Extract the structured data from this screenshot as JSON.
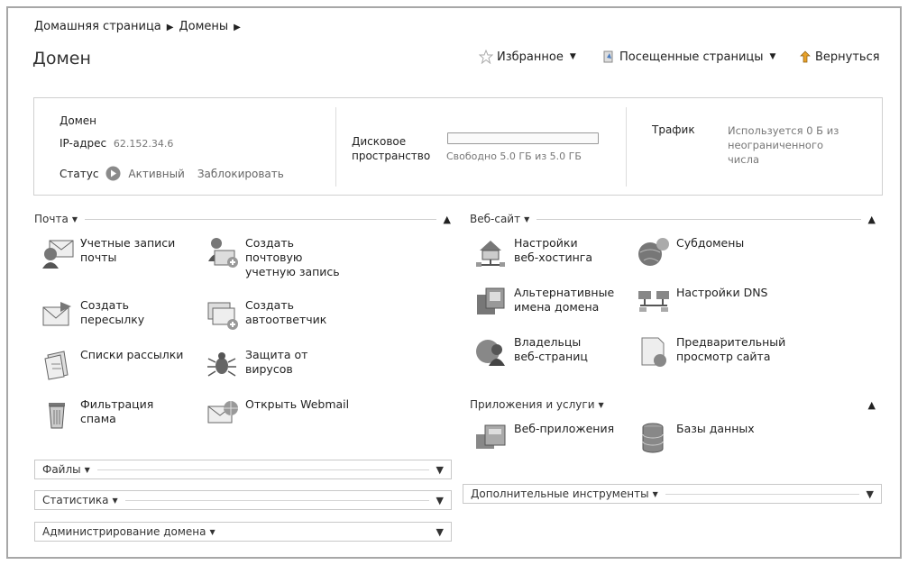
{
  "breadcrumb": {
    "items": [
      "Домашняя страница",
      "Домены"
    ],
    "separator": "▶"
  },
  "page_title": "Домен",
  "topnav": {
    "favorites": "Избранное",
    "visited": "Посещенные страницы",
    "back": "Вернуться"
  },
  "summary": {
    "domain_label": "Домен",
    "ip_label": "IP-адрес",
    "ip_value": "62.152.34.6",
    "status_label": "Статус",
    "status_value": "Активный",
    "block_action": "Заблокировать",
    "disk_label_1": "Дисковое",
    "disk_label_2": "пространство",
    "disk_value": "Свободно 5.0 ГБ из 5.0 ГБ",
    "disk_used_fraction": 0.0,
    "traffic_label": "Трафик",
    "traffic_value": "Используется 0 Б из\nнеограниченного\nчисла"
  },
  "sections": {
    "mail": {
      "title": "Почта",
      "items": [
        "Учетные записи\nпочты",
        "Создать\nпочтовую\nучетную запись",
        "Создать\nпересылку",
        "Создать\nавтоответчик",
        "Списки рассылки",
        "Защита от\nвирусов",
        "Фильтрация\nспама",
        "Открыть Webmail"
      ]
    },
    "website": {
      "title": "Веб-сайт",
      "items": [
        "Настройки\nвеб-хостинга",
        "Субдомены",
        "Альтернативные\nимена домена",
        "Настройки DNS",
        "Владельцы\nвеб-страниц",
        "Предварительный\nпросмотр сайта"
      ]
    },
    "apps": {
      "title": "Приложения и услуги",
      "items": [
        "Веб-приложения",
        "Базы данных"
      ]
    },
    "files": {
      "title": "Файлы"
    },
    "stats": {
      "title": "Статистика"
    },
    "admin": {
      "title": "Администрирование домена"
    },
    "tools": {
      "title": "Дополнительные инструменты"
    }
  },
  "colors": {
    "accent_green": "#6cbf55",
    "border": "#cfcfcf"
  }
}
